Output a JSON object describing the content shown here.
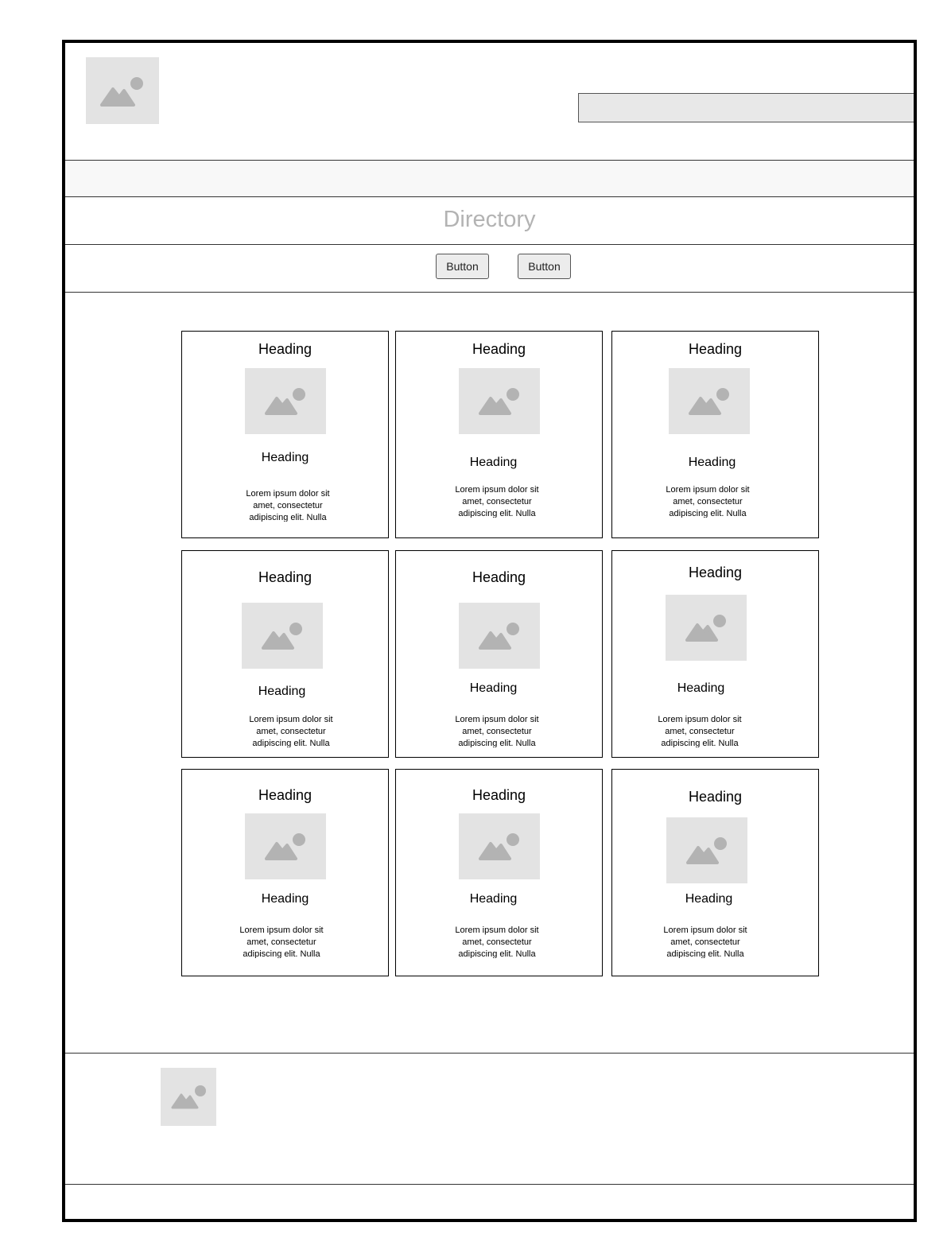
{
  "header": {
    "logo_icon": "image-placeholder-icon",
    "search": {
      "value": "",
      "placeholder": ""
    }
  },
  "page_title": "Directory",
  "toolbar": {
    "buttons": [
      {
        "label": "Button"
      },
      {
        "label": "Button"
      }
    ]
  },
  "cards": [
    {
      "heading": "Heading",
      "subheading": "Heading",
      "text": "Lorem ipsum dolor sit amet, consectetur adipiscing elit. Nulla"
    },
    {
      "heading": "Heading",
      "subheading": "Heading",
      "text": "Lorem ipsum dolor sit amet, consectetur adipiscing elit. Nulla"
    },
    {
      "heading": "Heading",
      "subheading": "Heading",
      "text": "Lorem ipsum dolor sit amet, consectetur adipiscing elit. Nulla"
    },
    {
      "heading": "Heading",
      "subheading": "Heading",
      "text": "Lorem ipsum dolor sit amet, consectetur adipiscing elit. Nulla"
    },
    {
      "heading": "Heading",
      "subheading": "Heading",
      "text": "Lorem ipsum dolor sit amet, consectetur adipiscing elit. Nulla"
    },
    {
      "heading": "Heading",
      "subheading": "Heading",
      "text": "Lorem ipsum dolor sit amet, consectetur adipiscing elit. Nulla"
    },
    {
      "heading": "Heading",
      "subheading": "Heading",
      "text": "Lorem ipsum dolor sit amet, consectetur adipiscing elit. Nulla"
    },
    {
      "heading": "Heading",
      "subheading": "Heading",
      "text": "Lorem ipsum dolor sit amet, consectetur adipiscing elit. Nulla"
    },
    {
      "heading": "Heading",
      "subheading": "Heading",
      "text": "Lorem ipsum dolor sit amet, consectetur adipiscing elit. Nulla"
    }
  ],
  "footer": {
    "logo_icon": "image-placeholder-icon"
  },
  "colors": {
    "placeholder_bg": "#e3e3e3",
    "placeholder_fg": "#b3b3b3",
    "title": "#b3b3b3"
  }
}
